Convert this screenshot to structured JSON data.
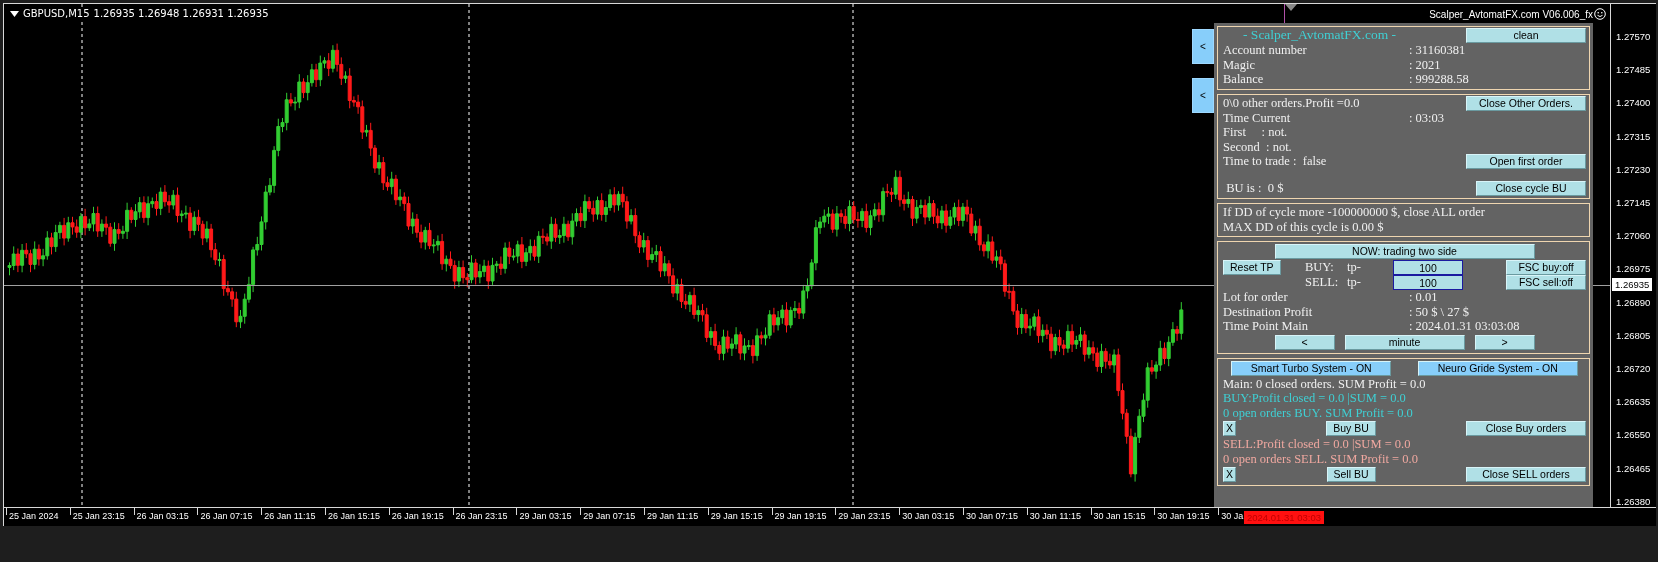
{
  "chart": {
    "symbol": "GBPUSD,M15",
    "ohlc": "1.26935 1.26948 1.26931 1.26935",
    "indicator_title": "Scalper_AvtomatFX.com V06.006_fx",
    "price_axis": [
      "1.27570",
      "1.27485",
      "1.27400",
      "1.27315",
      "1.27230",
      "1.27145",
      "1.27060",
      "1.26975",
      "1.26890",
      "1.26805",
      "1.26720",
      "1.26635",
      "1.26550",
      "1.26465",
      "1.26380"
    ],
    "current_price": "1.26935",
    "time_axis": [
      "25 Jan 2024",
      "25 Jan 23:15",
      "26 Jan 03:15",
      "26 Jan 07:15",
      "26 Jan 11:15",
      "26 Jan 15:15",
      "26 Jan 19:15",
      "26 Jan 23:15",
      "29 Jan 03:15",
      "29 Jan 07:15",
      "29 Jan 11:15",
      "29 Jan 15:15",
      "29 Jan 19:15",
      "29 Jan 23:15",
      "30 Jan 03:15",
      "30 Jan 07:15",
      "30 Jan 11:15",
      "30 Jan 15:15",
      "30 Jan 19:15",
      "30 Ja"
    ],
    "cursor_time": "2024.01.31 03:03"
  },
  "side_buttons": [
    "<",
    "<"
  ],
  "panel": {
    "sections": [
      {
        "kind": "info",
        "rows": [
          {
            "kind": "text",
            "text": "- Scalper_AvtomatFX.com -",
            "color": "#3fd0d4",
            "button": {
              "label": "clean",
              "kind": "action"
            }
          },
          {
            "kind": "kv",
            "label": "Account number",
            "value": ": 31160381"
          },
          {
            "kind": "kv",
            "label": "Magic",
            "value": ": 2021"
          },
          {
            "kind": "kv",
            "label": "Balance",
            "value": ": 999288.58"
          }
        ]
      },
      {
        "kind": "orders",
        "rows": [
          {
            "kind": "text",
            "text": "0\\0 other orders.Profit =0.0",
            "color": "#f0f0f0",
            "button": {
              "label": "Close Other Orders.",
              "kind": "action"
            }
          },
          {
            "kind": "kv",
            "label": "Time Current",
            "value": ": 03:03"
          },
          {
            "kind": "text",
            "text": "First     : not.",
            "color": "#f0f0f0"
          },
          {
            "kind": "text",
            "text": "Second  : not.",
            "color": "#f0f0f0"
          },
          {
            "kind": "text",
            "text": "Time to trade :  false",
            "color": "#f0f0f0",
            "button": {
              "label": "Open first order",
              "kind": "action"
            }
          },
          {
            "kind": "text",
            "text": " BU is :  0 $",
            "color": "#f0f0f0",
            "button": {
              "label": "Close cycle BU",
              "kind": "action"
            }
          }
        ]
      },
      {
        "kind": "risk",
        "rows": [
          {
            "kind": "text",
            "text": "If DD of cycle more -100000000 $, close ALL order",
            "color": "#f0f0f0"
          },
          {
            "kind": "text",
            "text": "MAX DD of this cycle is 0.00 $",
            "color": "#f0f0f0"
          }
        ]
      },
      {
        "kind": "trade",
        "rows": [
          {
            "kind": "buttons",
            "buttons": [
              {
                "label": "NOW: trading two side",
                "kind": "action"
              }
            ]
          },
          {
            "kind": "tp",
            "side": "BUY:",
            "prefix": "tp-",
            "value": "100",
            "left_button": {
              "label": "Reset TP",
              "kind": "action"
            },
            "right_button": {
              "label": "FSC buy:off",
              "kind": "action"
            }
          },
          {
            "kind": "tp",
            "side": "SELL:",
            "prefix": "tp-",
            "value": "100",
            "right_button": {
              "label": "FSC sell:off",
              "kind": "action"
            }
          },
          {
            "kind": "kv",
            "label": "Lot for order",
            "value": ": 0.01"
          },
          {
            "kind": "kv",
            "label": "Destination Profit",
            "value": ": 50 $ \\ 27 $"
          },
          {
            "kind": "kv",
            "label": "Time Point Main",
            "value": ": 2024.01.31 03:03:08"
          },
          {
            "kind": "buttons",
            "buttons": [
              {
                "label": "<",
                "kind": "action"
              },
              {
                "label": "minute",
                "kind": "action"
              },
              {
                "label": ">",
                "kind": "action"
              }
            ]
          }
        ]
      },
      {
        "kind": "results",
        "rows": [
          {
            "kind": "buttons",
            "buttons": [
              {
                "label": "Smart Turbo System - ON",
                "kind": "toggle"
              },
              {
                "label": "Neuro Gride System - ON",
                "kind": "toggle"
              }
            ]
          },
          {
            "kind": "text",
            "text": "Main: 0 closed orders. SUM Profit = 0.0",
            "color": "#f0f0f0"
          },
          {
            "kind": "text",
            "text": "BUY:Profit closed = 0.0 |SUM = 0.0",
            "color": "#3fd0d4"
          },
          {
            "kind": "text",
            "text": "0 open orders BUY. SUM Profit = 0.0",
            "color": "#3fd0d4"
          },
          {
            "kind": "actions",
            "buttons": [
              {
                "label": "X",
                "kind": "action"
              },
              {
                "label": "Buy BU",
                "kind": "action"
              },
              {
                "label": "Close Buy orders",
                "kind": "action"
              }
            ]
          },
          {
            "kind": "text",
            "text": "SELL:Profit closed = 0.0 |SUM = 0.0",
            "color": "#f0a8a0"
          },
          {
            "kind": "text",
            "text": "0 open orders SELL. SUM Profit = 0.0",
            "color": "#f0a8a0"
          },
          {
            "kind": "actions",
            "buttons": [
              {
                "label": "X",
                "kind": "action"
              },
              {
                "label": "Sell BU",
                "kind": "action"
              },
              {
                "label": "Close SELL orders",
                "kind": "action"
              }
            ]
          }
        ]
      }
    ]
  }
}
